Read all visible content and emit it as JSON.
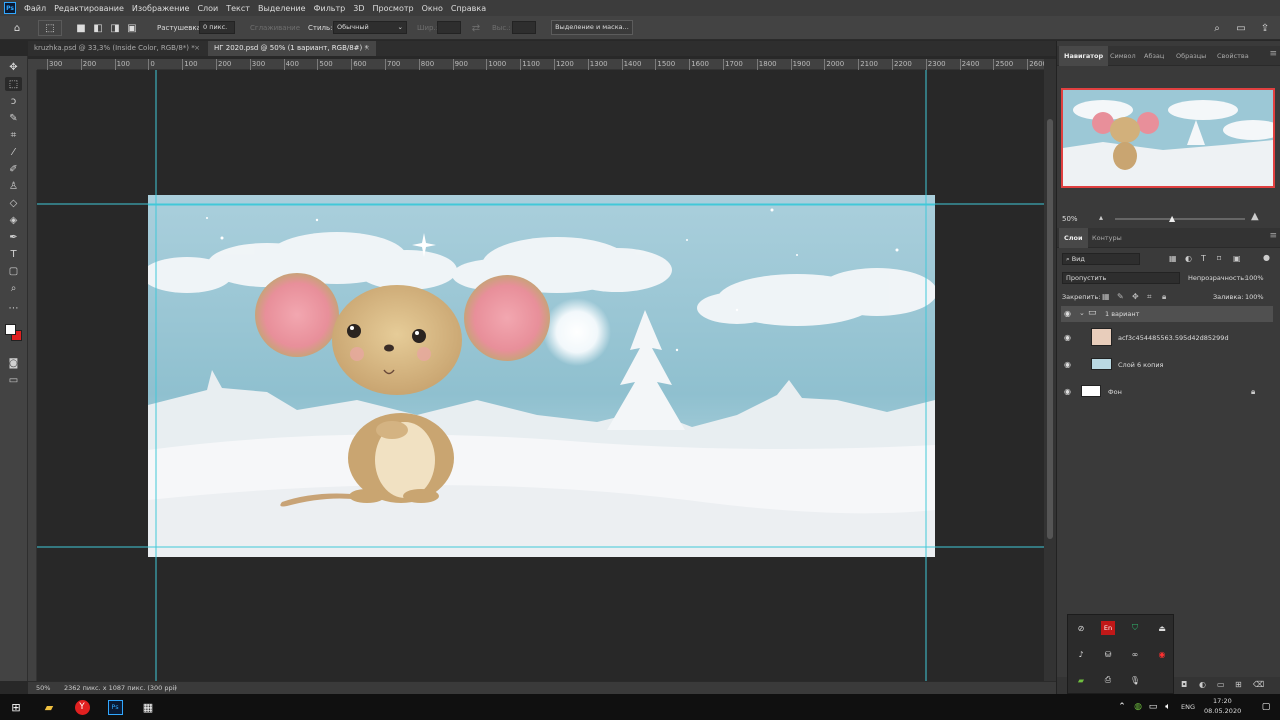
{
  "menubar": {
    "logo": "Ps",
    "items": [
      "Файл",
      "Редактирование",
      "Изображение",
      "Слои",
      "Текст",
      "Выделение",
      "Фильтр",
      "3D",
      "Просмотр",
      "Окно",
      "Справка"
    ]
  },
  "options": {
    "feather_label": "Растушевка:",
    "feather_value": "0 пикс.",
    "antialias_label": "Сглаживание",
    "style_label": "Стиль:",
    "style_value": "Обычный",
    "width_label": "Шир.:",
    "height_label": "Выс.:",
    "select_mask_button": "Выделение и маска..."
  },
  "tabs": [
    {
      "title": "kruzhka.psd @ 33,3% (Inside Color, RGB/8*) *",
      "active": false
    },
    {
      "title": "НГ 2020.psd @ 50% (1 вариант, RGB/8#) *",
      "active": true
    }
  ],
  "ruler": {
    "labels": [
      "300",
      "200",
      "100",
      "0",
      "100",
      "200",
      "300",
      "400",
      "500",
      "600",
      "700",
      "800",
      "900",
      "1000",
      "1100",
      "1200",
      "1300",
      "1400",
      "1500",
      "1600",
      "1700",
      "1800",
      "1900",
      "2000",
      "2100",
      "2200",
      "2300",
      "2400",
      "2500",
      "2600"
    ]
  },
  "status": {
    "zoom": "50%",
    "doc_info": "2362 пикс. x 1087 пикс. (300 ppi)"
  },
  "navigator": {
    "tabs": [
      "Навигатор",
      "Символ",
      "Абзац",
      "Образцы",
      "Свойства"
    ],
    "zoom": "50%"
  },
  "layers_panel": {
    "tabs": [
      "Слои",
      "Контуры"
    ],
    "filter_kind": "Вид",
    "blend_mode": "Пропустить",
    "opacity_label": "Непрозрачность:",
    "opacity_value": "100%",
    "lock_label": "Закрепить:",
    "fill_label": "Заливка:",
    "fill_value": "100%",
    "layers": [
      {
        "name": "1 вариант",
        "type": "group"
      },
      {
        "name": "acf3c454485563.595d42d85299d",
        "type": "image"
      },
      {
        "name": "Слой 6 копия",
        "type": "image"
      },
      {
        "name": "Фон",
        "type": "background"
      }
    ]
  },
  "tray": {
    "lang": "ENG",
    "time": "17:20",
    "date": "08.05.2020",
    "en_badge": "En"
  },
  "colors": {
    "accent": "#31a8ff",
    "guide": "#41c8d8",
    "foreground": "#ffffff",
    "background": "#e02020"
  }
}
